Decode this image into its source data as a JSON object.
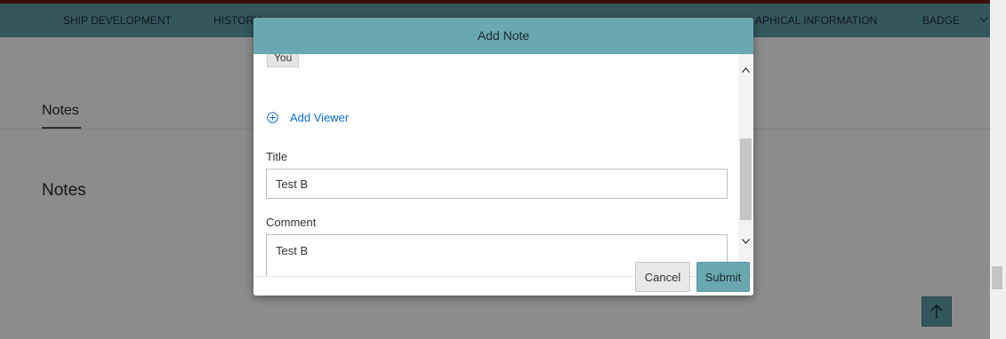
{
  "nav": {
    "items": [
      {
        "label": "SHIP DEVELOPMENT"
      },
      {
        "label": "HISTORY"
      },
      {
        "label": "APHICAL INFORMATION"
      },
      {
        "label": "BADGE"
      }
    ]
  },
  "content": {
    "tab_label": "Notes",
    "heading": "Notes"
  },
  "dialog": {
    "title": "Add Note",
    "viewer_chip": "You",
    "add_viewer_label": "Add Viewer",
    "title_field": {
      "label": "Title",
      "value": "Test B"
    },
    "comment_field": {
      "label": "Comment",
      "value": "Test B"
    },
    "cancel_label": "Cancel",
    "submit_label": "Submit"
  },
  "colors": {
    "nav_background": "#5f9ea7",
    "dialog_header": "#6aa8b1",
    "link": "#0a6ed1"
  },
  "icons": {
    "add_viewer": "plus-circle-icon",
    "scroll_top": "arrow-up-icon",
    "nav_more": "chevron-down-icon"
  }
}
